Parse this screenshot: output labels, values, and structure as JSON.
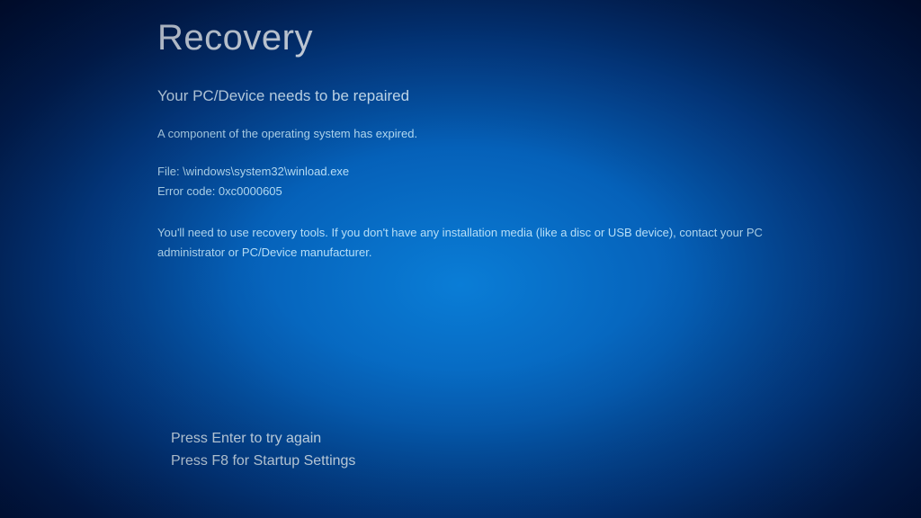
{
  "title": "Recovery",
  "subtitle": "Your PC/Device needs to be repaired",
  "description": "A component of the operating system has expired.",
  "file_label": "File: ",
  "file_path": "\\windows\\system32\\winload.exe",
  "error_label": "Error code: ",
  "error_code": "0xc0000605",
  "instructions": "You'll need to use recovery tools. If you don't have any installation media (like a disc or USB device), contact your PC administrator or PC/Device manufacturer.",
  "actions": {
    "retry": "Press Enter to try again",
    "startup": "Press F8 for Startup Settings"
  }
}
